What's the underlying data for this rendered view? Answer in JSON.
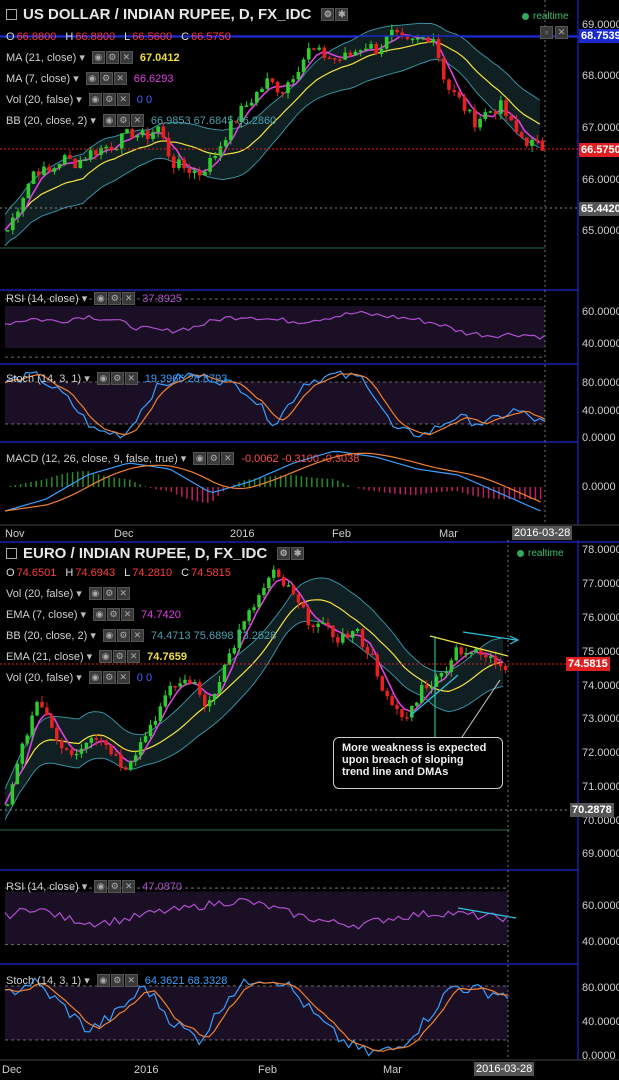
{
  "chart1": {
    "title": "US DOLLAR / INDIAN RUPEE, D, FX_IDC",
    "realtime": "realtime",
    "ohlc": {
      "o_label": "O",
      "o": "66.8800",
      "h_label": "H",
      "h": "66.8800",
      "l_label": "L",
      "l": "66.5600",
      "c_label": "C",
      "c": "66.5750"
    },
    "indicators": [
      {
        "label": "MA (21, close)",
        "value": "67.0412",
        "color": "#f0e040"
      },
      {
        "label": "MA (7, close)",
        "value": "66.6293",
        "color": "#e040e0"
      },
      {
        "label": "Vol (20, false)",
        "value": "0  0",
        "color": "#4060ff"
      },
      {
        "label": "BB (20, close, 2)",
        "value": "66.9853  67.6845  66.2860",
        "color": "#4aa0b0"
      }
    ],
    "price_axis": [
      "69.0000",
      "68.0000",
      "67.0000",
      "66.0000",
      "65.0000"
    ],
    "tags": [
      {
        "text": "68.7539",
        "bg": "#1a2acc",
        "color": "#ffffff"
      },
      {
        "text": "66.5750",
        "bg": "#e02020",
        "color": "#ffffff"
      },
      {
        "text": "65.4420",
        "bg": "#555555",
        "color": "#ffffff"
      }
    ],
    "rsi": {
      "label": "RSI (14, close)",
      "value": "37.8925",
      "axis": [
        "60.0000",
        "40.0000"
      ]
    },
    "stoch": {
      "label": "Stoch (14, 3, 1)",
      "value": "19.3966  28.8793",
      "axis": [
        "80.0000",
        "40.0000",
        "0.0000"
      ]
    },
    "macd": {
      "label": "MACD (12, 26, close, 9, false, true)",
      "value": "-0.0062  -0.3100  -0.3038",
      "axis": [
        "0.0000"
      ]
    },
    "time_axis": [
      "Nov",
      "Dec",
      "2016",
      "Feb",
      "Mar"
    ],
    "date_tag": "2016-03-28"
  },
  "chart2": {
    "title": "EURO / INDIAN RUPEE, D, FX_IDC",
    "realtime": "realtime",
    "ohlc": {
      "o_label": "O",
      "o": "74.6501",
      "h_label": "H",
      "h": "74.6943",
      "l_label": "L",
      "l": "74.2810",
      "c_label": "C",
      "c": "74.5815"
    },
    "indicators": [
      {
        "label": "Vol (20, false)",
        "value": "",
        "color": "#4060ff"
      },
      {
        "label": "EMA (7, close)",
        "value": "74.7420",
        "color": "#e040e0"
      },
      {
        "label": "BB (20, close, 2)",
        "value": "74.4713  75.6898  73.2528",
        "color": "#4aa0b0"
      },
      {
        "label": "EMA (21, close)",
        "value": "74.7659",
        "color": "#f0e040"
      },
      {
        "label": "Vol (20, false)",
        "value": "0  0",
        "color": "#4060ff"
      }
    ],
    "price_axis": [
      "78.0000",
      "77.0000",
      "76.0000",
      "75.0000",
      "74.0000",
      "73.0000",
      "72.0000",
      "71.0000",
      "70.0000",
      "69.0000"
    ],
    "tags": [
      {
        "text": "74.5815",
        "bg": "#e02020",
        "color": "#ffffff"
      },
      {
        "text": "70.2878",
        "bg": "#555555",
        "color": "#ffffff"
      }
    ],
    "annotation": "More weakness is expected upon breach of sloping trend line and DMAs",
    "rsi": {
      "label": "RSI (14, close)",
      "value": "47.0870",
      "axis": [
        "60.0000",
        "40.0000"
      ]
    },
    "stoch": {
      "label": "Stoch (14, 3, 1)",
      "value": "64.3621  68.3328",
      "axis": [
        "80.0000",
        "40.0000",
        "0.0000"
      ]
    },
    "time_axis": [
      "Dec",
      "2016",
      "Feb",
      "Mar"
    ],
    "date_tag": "2016-03-28"
  },
  "colors": {
    "up": "#2ecc2e",
    "down": "#e82020",
    "bb": "#3a8fa0",
    "bbfill": "#0f1f22",
    "ma_slow": "#f0e040",
    "ma_fast": "#e040e0",
    "panel_border": "#1a2acc"
  }
}
